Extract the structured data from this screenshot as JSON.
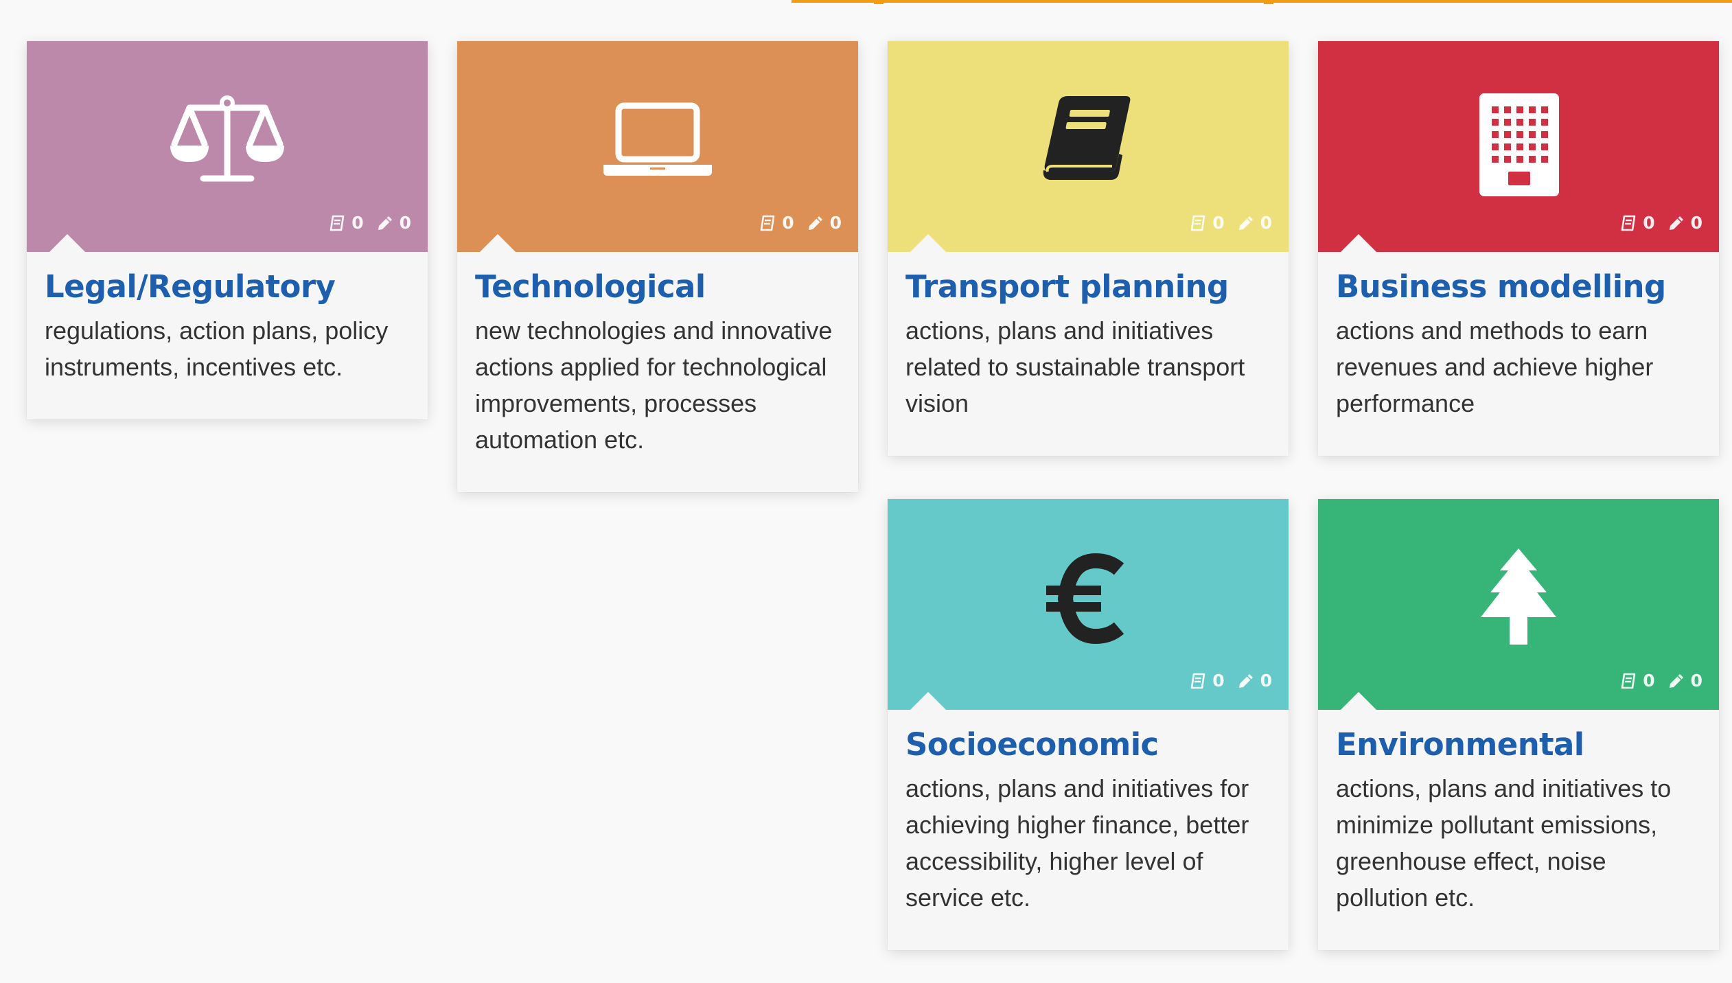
{
  "cards": [
    {
      "title": "Legal/Regulatory",
      "description": "regulations, action plans, policy instruments, incentives etc.",
      "color": "#bc89aa",
      "icon": "scales-icon",
      "documents": "0",
      "edits": "0"
    },
    {
      "title": "Technological",
      "description": "new technologies and innovative actions applied for technological improvements, processes automation etc.",
      "color": "#dc9055",
      "icon": "laptop-icon",
      "documents": "0",
      "edits": "0"
    },
    {
      "title": "Transport planning",
      "description": "actions, plans and initiatives related to sustainable transport vision",
      "color": "#ede07a",
      "icon": "book-icon",
      "documents": "0",
      "edits": "0"
    },
    {
      "title": "Business modelling",
      "description": "actions and methods to earn revenues and achieve higher performance",
      "color": "#d03042",
      "icon": "building-icon",
      "documents": "0",
      "edits": "0"
    },
    {
      "title": "Socioeconomic",
      "description": "actions, plans and initiatives for achieving higher finance, better accessibility, higher level of service etc.",
      "color": "#65c8c9",
      "icon": "euro-icon",
      "documents": "0",
      "edits": "0"
    },
    {
      "title": "Environmental",
      "description": "actions, plans and initiatives to minimize pollutant emissions, greenhouse effect, noise pollution etc.",
      "color": "#37b579",
      "icon": "tree-icon",
      "documents": "0",
      "edits": "0"
    }
  ]
}
